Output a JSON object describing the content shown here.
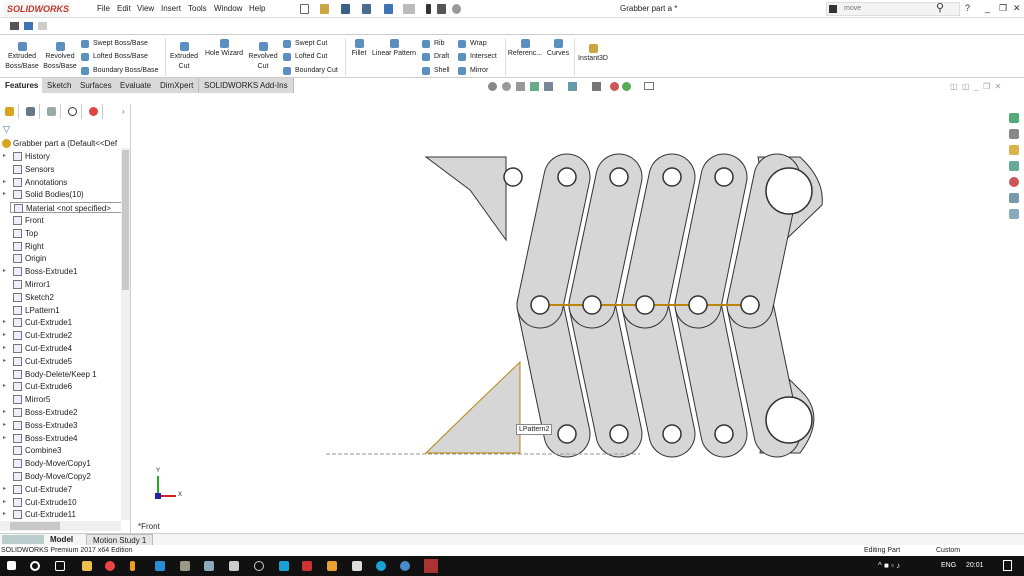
{
  "app": {
    "logo": "SOLIDWORKS",
    "title": "Grabber part a *",
    "search_value": "move"
  },
  "menu": [
    "File",
    "Edit",
    "View",
    "Insert",
    "Tools",
    "Window",
    "Help"
  ],
  "ribbon": {
    "big": [
      {
        "label": "Extruded\nBoss/Base"
      },
      {
        "label": "Revolved\nBoss/Base"
      },
      {
        "label": "Extruded\nCut"
      },
      {
        "label": "Hole Wizard"
      },
      {
        "label": "Revolved\nCut"
      },
      {
        "label": "Fillet"
      },
      {
        "label": "Linear Pattern"
      },
      {
        "label": "Referenc..."
      },
      {
        "label": "Curves"
      },
      {
        "label": "Instant3D"
      }
    ],
    "small": [
      "Swept Boss/Base",
      "Lofted Boss/Base",
      "Boundary Boss/Base",
      "Swept Cut",
      "Lofted Cut",
      "Boundary Cut",
      "Rib",
      "Draft",
      "Shell",
      "Wrap",
      "Intersect",
      "Mirror"
    ]
  },
  "tabs": [
    "Features",
    "Sketch",
    "Surfaces",
    "Evaluate",
    "DimXpert",
    "SOLIDWORKS Add-Ins"
  ],
  "tree": {
    "root": "Grabber part a  (Default<<Def",
    "items": [
      {
        "label": "History",
        "exp": true
      },
      {
        "label": "Sensors",
        "exp": false
      },
      {
        "label": "Annotations",
        "exp": true
      },
      {
        "label": "Solid Bodies(10)",
        "exp": true
      },
      {
        "label": "Material <not specified>",
        "exp": false
      },
      {
        "label": "Front",
        "exp": false
      },
      {
        "label": "Top",
        "exp": false
      },
      {
        "label": "Right",
        "exp": false
      },
      {
        "label": "Origin",
        "exp": false
      },
      {
        "label": "Boss-Extrude1",
        "exp": true
      },
      {
        "label": "Mirror1",
        "exp": false
      },
      {
        "label": "Sketch2",
        "exp": false
      },
      {
        "label": "LPattern1",
        "exp": false
      },
      {
        "label": "Cut-Extrude1",
        "exp": true
      },
      {
        "label": "Cut-Extrude2",
        "exp": true
      },
      {
        "label": "Cut-Extrude4",
        "exp": true
      },
      {
        "label": "Cut-Extrude5",
        "exp": true
      },
      {
        "label": "Body-Delete/Keep 1",
        "exp": false
      },
      {
        "label": "Cut-Extrude6",
        "exp": true
      },
      {
        "label": "Mirror5",
        "exp": false
      },
      {
        "label": "Boss-Extrude2",
        "exp": true
      },
      {
        "label": "Boss-Extrude3",
        "exp": true
      },
      {
        "label": "Boss-Extrude4",
        "exp": true
      },
      {
        "label": "Combine3",
        "exp": false
      },
      {
        "label": "Body-Move/Copy1",
        "exp": false
      },
      {
        "label": "Body-Move/Copy2",
        "exp": false
      },
      {
        "label": "Cut-Extrude7",
        "exp": true
      },
      {
        "label": "Cut-Extrude10",
        "exp": true
      },
      {
        "label": "Cut-Extrude11",
        "exp": true
      }
    ]
  },
  "viewport": {
    "view_label": "*Front",
    "tooltip": "LPattern2",
    "axis_x": "X",
    "axis_y": "Y"
  },
  "bottom_tabs": [
    "Model",
    "Motion Study 1"
  ],
  "status": {
    "edition": "SOLIDWORKS Premium 2017 x64 Edition",
    "mode": "Editing Part",
    "units": "Custom"
  },
  "taskbar": {
    "lang": "ENG",
    "time": "20:01"
  }
}
